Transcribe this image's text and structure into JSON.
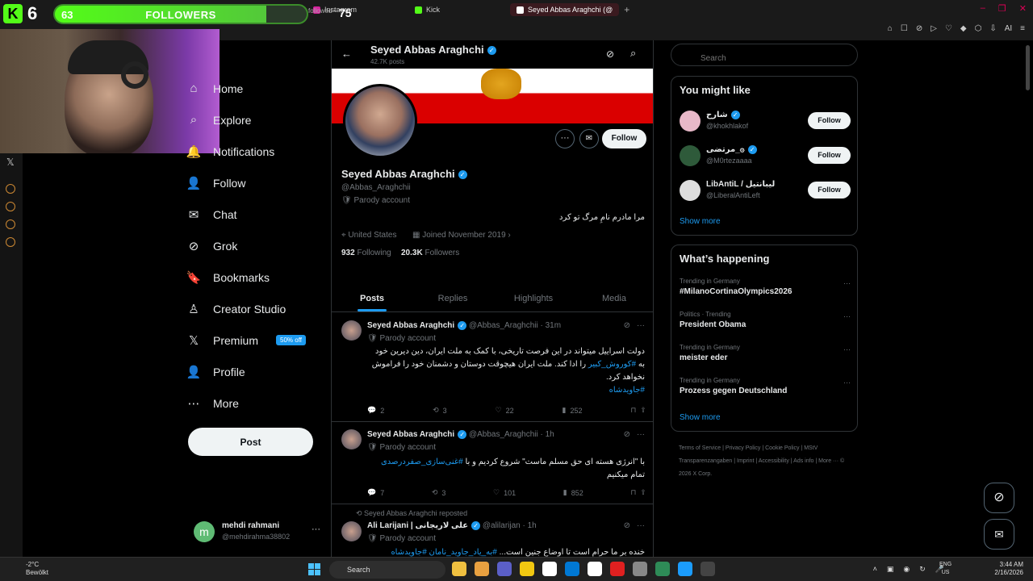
{
  "browser": {
    "tabs": [
      {
        "label": "Instagram",
        "color": "#d6249f"
      },
      {
        "label": "Kick",
        "color": "#53fc18"
      },
      {
        "label": "Seyed Abbas Araghchi (@",
        "color": "#ffffff"
      }
    ],
    "new_tab": "+",
    "window_controls": [
      "–",
      "❐",
      "✕"
    ],
    "toolbar_icons": [
      "⌂",
      "☐",
      "⊘",
      "▷",
      "♡",
      "◆",
      "⬡",
      "⇩",
      "AI",
      "≡"
    ]
  },
  "overlay": {
    "logo_letter": "K",
    "count": "6",
    "followers_current": "63",
    "followers_label": "FOLLOWERS",
    "followed_note": "followed •",
    "followers_goal": "75",
    "progress_fraction": 0.84,
    "accent_color": "#53fc18"
  },
  "nav": {
    "items": [
      {
        "label": "Home",
        "icon": "home-icon",
        "glyph": "⌂"
      },
      {
        "label": "Explore",
        "icon": "search-icon",
        "glyph": "⌕"
      },
      {
        "label": "Notifications",
        "icon": "bell-icon",
        "glyph": "🔔"
      },
      {
        "label": "Follow",
        "icon": "add-person-icon",
        "glyph": "👤"
      },
      {
        "label": "Chat",
        "icon": "mail-icon",
        "glyph": "✉"
      },
      {
        "label": "Grok",
        "icon": "grok-icon",
        "glyph": "⊘"
      },
      {
        "label": "Bookmarks",
        "icon": "bookmark-icon",
        "glyph": "🔖"
      },
      {
        "label": "Creator Studio",
        "icon": "creator-icon",
        "glyph": "♙"
      },
      {
        "label": "Premium",
        "icon": "x-logo-icon",
        "glyph": "𝕏"
      },
      {
        "label": "Profile",
        "icon": "person-icon",
        "glyph": "👤"
      },
      {
        "label": "More",
        "icon": "more-circle-icon",
        "glyph": "⋯"
      }
    ],
    "premium_badge": "50% off",
    "post_label": "Post",
    "x_logo": "𝕏"
  },
  "account": {
    "avatar_letter": "m",
    "name": "mehdi rahmani",
    "handle": "@mehdirahma38802",
    "more": "···"
  },
  "profile": {
    "header_name": "Seyed Abbas Araghchi",
    "header_posts": "42.7K posts",
    "name": "Seyed Abbas Araghchi",
    "handle": "@Abbas_Araghchii",
    "parody": "Parody account",
    "bio": "مرا مادرم نامِ مرگ تو کرد",
    "location": "United States",
    "joined": "Joined November 2019",
    "following_count": "932",
    "following_label": "Following",
    "followers_count": "20.3K",
    "followers_label": "Followers",
    "follow_label": "Follow",
    "more_glyph": "···",
    "message_glyph": "✉"
  },
  "tabs": [
    "Posts",
    "Replies",
    "Highlights",
    "Media"
  ],
  "tweets": [
    {
      "name": "Seyed Abbas Araghchi",
      "handle": "@Abbas_Araghchii · 31m",
      "parody": "Parody account",
      "text": "دولت اسراییل میتواند در این فرصت تاریخی، با کمک به ملت ایران، دین دیرین خود به",
      "link1": "#کوروش_کبیر",
      "text2": " را ادا کند. ملت ایران هیچوقت دوستان و دشمنان خود را فراموش نخواهد کرد.",
      "link2": "#جاویدشاه",
      "replies": "2",
      "reposts": "3",
      "likes": "22",
      "views": "252"
    },
    {
      "name": "Seyed Abbas Araghchi",
      "handle": "@Abbas_Araghchii · 1h",
      "parody": "Parody account",
      "text": "با \"انرژی هسته ای حق مسلم ماست\" شروع کردیم و با ",
      "link1": "#غنی‌سازی_صفردرصدی",
      "text2": " تمام میکنیم",
      "replies": "7",
      "reposts": "3",
      "likes": "101",
      "views": "852"
    },
    {
      "repost_note": "Seyed Abbas Araghchi reposted",
      "name": "Ali Larijani | علی لاریجانی",
      "handle": "@alilarijan · 1h",
      "parody": "Parody account",
      "text": "خنده بر ما حرام است تا اوضاع جنین است... ",
      "link1": "#به_یاد_جاوید_نامان #جاویدشاه"
    }
  ],
  "sidebar": {
    "search_placeholder": "Search",
    "suggest_title": "You might like",
    "suggestions": [
      {
        "name": "شارح",
        "handle": "@khokhlakof",
        "follow": "Follow",
        "color": "#e8b8c8"
      },
      {
        "name": "مرتضی_۞",
        "handle": "@M0rtezaaaa",
        "follow": "Follow",
        "color": "#2e5a3a"
      },
      {
        "name": "LibAntiL / لیبانتیل",
        "handle": "@LiberalAntiLeft",
        "follow": "Follow",
        "color": "#dddddd"
      }
    ],
    "show_more": "Show more",
    "happening_title": "What’s happening",
    "trends": [
      {
        "category": "Trending in Germany",
        "name": "#MilanoCortinaOlympics2026"
      },
      {
        "category": "Politics · Trending",
        "name": "President Obama"
      },
      {
        "category": "Trending in Germany",
        "name": "meister eder"
      },
      {
        "category": "Trending in Germany",
        "name": "Prozess gegen Deutschland"
      }
    ],
    "show_more_2": "Show more",
    "footer": "Terms of Service | Privacy Policy | Cookie Policy | MStV Transparenzangaben | Imprint | Accessibility | Ads info | More ··· © 2026 X Corp."
  },
  "taskbar": {
    "temp": "-2°C",
    "weather": "Bewölkt",
    "search": "Search",
    "lang1": "ENG",
    "lang2": "US",
    "time": "3:44 AM",
    "date": "2/16/2026",
    "app_colors": [
      "#f0c040",
      "#e8a040",
      "#5b5fc7",
      "#f2c811",
      "#ffffff",
      "#0078d4",
      "#ffffff",
      "#e02020",
      "#888888",
      "#2e8b57",
      "#1b9cfc",
      "#444444"
    ]
  }
}
